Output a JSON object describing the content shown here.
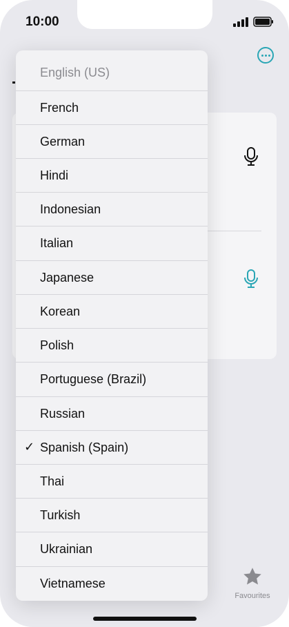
{
  "status_bar": {
    "time": "10:00"
  },
  "background": {
    "tab_favourites": "Favourites"
  },
  "menu": {
    "items": [
      {
        "label": "English (US)",
        "state": "disabled"
      },
      {
        "label": "French"
      },
      {
        "label": "German"
      },
      {
        "label": "Hindi"
      },
      {
        "label": "Indonesian"
      },
      {
        "label": "Italian"
      },
      {
        "label": "Japanese"
      },
      {
        "label": "Korean"
      },
      {
        "label": "Polish"
      },
      {
        "label": "Portuguese (Brazil)"
      },
      {
        "label": "Russian"
      },
      {
        "label": "Spanish (Spain)",
        "state": "selected"
      },
      {
        "label": "Thai"
      },
      {
        "label": "Turkish"
      },
      {
        "label": "Ukrainian"
      },
      {
        "label": "Vietnamese"
      }
    ],
    "checkmark": "✓"
  },
  "colors": {
    "accent": "#2aa6b5",
    "menu_bg": "#f2f2f4",
    "app_bg": "#e9e9ee"
  }
}
